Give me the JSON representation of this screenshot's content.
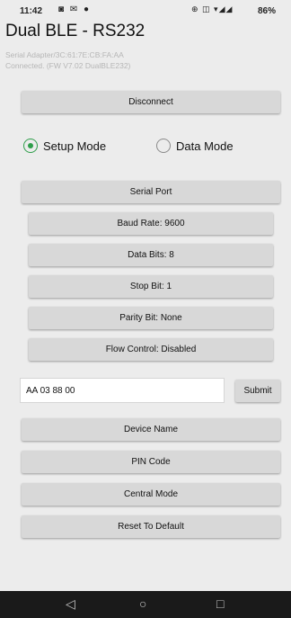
{
  "status_bar": {
    "time": "11:42",
    "left_icons": "◙ ✉ ●",
    "right_icons": "⊕ ◫ ▾◢◢",
    "battery": "86%"
  },
  "app": {
    "title": "Dual BLE - RS232",
    "device_line": "Serial Adapter/3C:61:7E:CB:FA:AA",
    "connection_line": "Connected. (FW V7.02 DualBLE232)"
  },
  "buttons": {
    "disconnect": "Disconnect",
    "serial_port": "Serial Port",
    "baud_rate": "Baud Rate: 9600",
    "data_bits": "Data Bits: 8",
    "stop_bit": "Stop Bit: 1",
    "parity_bit": "Parity Bit: None",
    "flow_control": "Flow Control: Disabled",
    "submit": "Submit",
    "device_name": "Device Name",
    "pin_code": "PIN Code",
    "central_mode": "Central Mode",
    "reset_default": "Reset To Default"
  },
  "mode": {
    "setup_label": "Setup Mode",
    "data_label": "Data Mode",
    "selected": "Setup Mode"
  },
  "command_input": {
    "value": "AA 03 88 00"
  },
  "nav": {
    "back": "◁",
    "home": "○",
    "recents": "□"
  },
  "colors": {
    "accent": "#2e9e4a",
    "button_bg": "#d8d8d8",
    "background": "#ececec"
  }
}
